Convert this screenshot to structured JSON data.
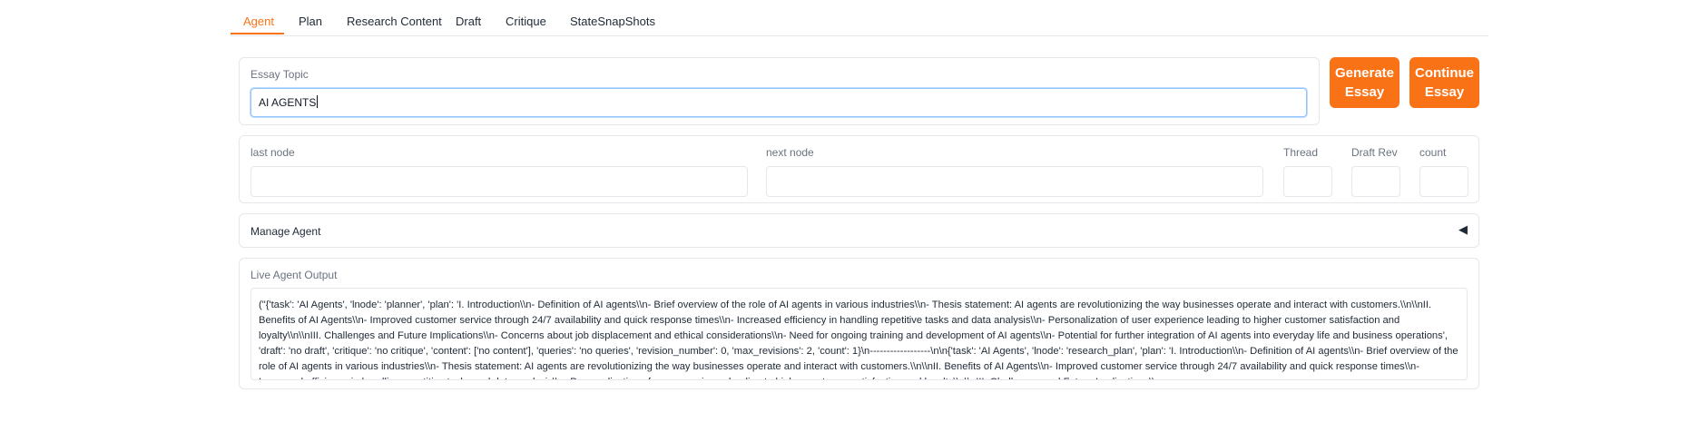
{
  "tabs": [
    {
      "label": "Agent",
      "active": true
    },
    {
      "label": "Plan"
    },
    {
      "label": "Research Content"
    },
    {
      "label": "Draft"
    },
    {
      "label": "Critique"
    },
    {
      "label": "StateSnapShots"
    }
  ],
  "topic": {
    "label": "Essay Topic",
    "value": "AI AGENTS"
  },
  "buttons": {
    "generate": "Generate Essay",
    "continue": "Continue Essay"
  },
  "state": {
    "last_node_label": "last node",
    "last_node_value": "",
    "next_node_label": "next node",
    "next_node_value": "",
    "thread_label": "Thread",
    "thread_value": "",
    "draft_rev_label": "Draft Rev",
    "draft_rev_value": "",
    "count_label": "count",
    "count_value": ""
  },
  "manage": {
    "label": "Manage Agent",
    "toggle_icon": "◀"
  },
  "output": {
    "label": "Live Agent Output",
    "text": "(\"{'task': 'AI Agents', 'lnode': 'planner', 'plan': 'I. Introduction\\\\n- Definition of AI agents\\\\n- Brief overview of the role of AI agents in various industries\\\\n- Thesis statement: AI agents are revolutionizing the way businesses operate and interact with customers.\\\\n\\\\nII. Benefits of AI Agents\\\\n- Improved customer service through 24/7 availability and quick response times\\\\n- Increased efficiency in handling repetitive tasks and data analysis\\\\n- Personalization of user experience leading to higher customer satisfaction and loyalty\\\\n\\\\nIII. Challenges and Future Implications\\\\n- Concerns about job displacement and ethical considerations\\\\n- Need for ongoing training and development of AI agents\\\\n- Potential for further integration of AI agents into everyday life and business operations', 'draft': 'no draft', 'critique': 'no critique', 'content': ['no content'], 'queries': 'no queries', 'revision_number': 0, 'max_revisions': 2, 'count': 1}\\n------------------\\n\\n{'task': 'AI Agents', 'lnode': 'research_plan', 'plan': 'I. Introduction\\\\n- Definition of AI agents\\\\n- Brief overview of the role of AI agents in various industries\\\\n- Thesis statement: AI agents are revolutionizing the way businesses operate and interact with customers.\\\\n\\\\nII. Benefits of AI Agents\\\\n- Improved customer service through 24/7 availability and quick response times\\\\n- Increased efficiency in handling repetitive tasks and data analysis\\\\n- Personalization of user experience leading to higher customer satisfaction and loyalty\\\\n\\\\nIII. Challenges and Future Implications\\\\n-"
  }
}
